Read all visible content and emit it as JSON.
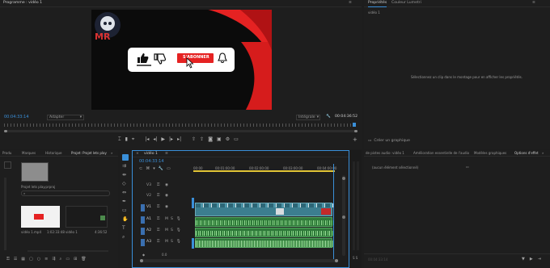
{
  "program_monitor": {
    "tab": "Programme : vidéo 1",
    "timecode": "00:04:33:14",
    "fit": "Adapter",
    "quality": "Intégrale",
    "duration": "00:04:36:52",
    "overlay": {
      "subscribe_label": "S'ABONNER",
      "logo_text": "MR"
    }
  },
  "properties_panel": {
    "tabs": [
      "Propriétés",
      "Couleur Lumetri"
    ],
    "subtitle": "vidéo 1",
    "empty_message": "Sélectionnez un clip dans le montage pour en afficher les propriétés.",
    "create_graphic": "Créer un graphique"
  },
  "project_panel": {
    "tabs": [
      "Produ",
      "Marques",
      "Historique",
      "Projet: Projet lets play"
    ],
    "project_file": "Projet lets play.prproj",
    "items": [
      {
        "name": "vidéo 1.mp4",
        "duration": "1:02:33:48"
      },
      {
        "name": "vidéo 1",
        "duration": "4:36:52"
      }
    ]
  },
  "timeline": {
    "tab": "vidéo 1",
    "timecode": "00:04:33:14",
    "ruler": [
      "00:00",
      "00:01:00:00",
      "00:02:00:00",
      "00:03:00:00",
      "00:04:00:00"
    ],
    "tracks": [
      "V3",
      "V2",
      "V1",
      "A1",
      "A2",
      "A3"
    ],
    "master_value": "0.0"
  },
  "effects_panel": {
    "tabs": [
      "de pistes audio: vidéo 1",
      "Amélioration essentielle de l'audio",
      "Modèles graphiques",
      "Options d'effet"
    ],
    "no_selection": "(aucun élément sélectionné)",
    "timecode": "00:04:33:14"
  },
  "colors": {
    "accent": "#3a8fd9",
    "red": "#e52222",
    "clip_video": "#3c7e8f",
    "clip_audio": "#2f7a3a"
  }
}
